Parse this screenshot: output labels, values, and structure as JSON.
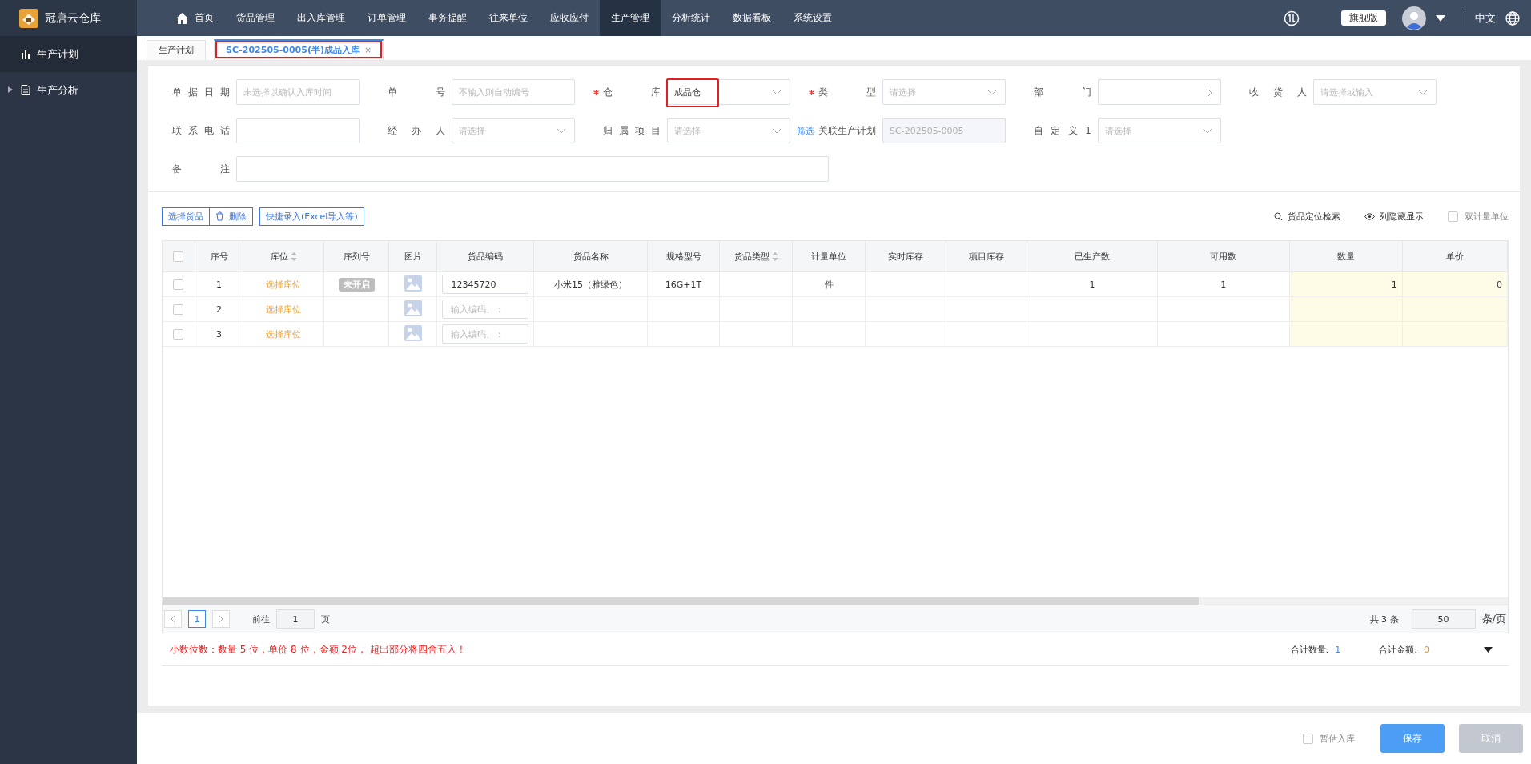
{
  "brand": {
    "name": "冠唐云仓库"
  },
  "nav": [
    {
      "label": "首页",
      "kind": "home",
      "selected": false
    },
    {
      "label": "货品管理",
      "selected": false
    },
    {
      "label": "出入库管理",
      "selected": false
    },
    {
      "label": "订单管理",
      "selected": false
    },
    {
      "label": "事务提醒",
      "selected": false
    },
    {
      "label": "往来单位",
      "selected": false
    },
    {
      "label": "应收应付",
      "selected": false
    },
    {
      "label": "生产管理",
      "selected": true
    },
    {
      "label": "分析统计",
      "selected": false
    },
    {
      "label": "数据看板",
      "selected": false
    },
    {
      "label": "系统设置",
      "selected": false
    }
  ],
  "header_right": {
    "edition": "旗舰版",
    "language": "中文"
  },
  "sidebar": {
    "items": [
      {
        "label": "生产计划",
        "kind": "chart",
        "selected": true
      },
      {
        "label": "生产分析",
        "kind": "doc",
        "selected": false,
        "expanded": false
      }
    ]
  },
  "tabs": [
    {
      "label": "生产计划",
      "selected": false,
      "highlighted": false
    },
    {
      "label": "SC-202505-0005(半)成品入库",
      "selected": true,
      "highlighted": true,
      "close": "×"
    }
  ],
  "form": {
    "rows": [
      [
        {
          "label": "单据日期",
          "kind": "text",
          "placeholder": "未选择以确认入库时间"
        },
        {
          "label": "单号",
          "kind": "text",
          "placeholder": "不输入则自动编号"
        },
        {
          "label": "仓库",
          "kind": "select",
          "required": true,
          "value": "成品仓",
          "highlighted": true
        },
        {
          "label": "类型",
          "kind": "select",
          "required": true,
          "placeholder": "请选择"
        },
        {
          "label": "部门",
          "kind": "cascade"
        },
        {
          "label": "收货人",
          "kind": "select",
          "placeholder": "请选择或输入"
        }
      ],
      [
        {
          "label": "联系电话",
          "kind": "text"
        },
        {
          "label": "经办人",
          "kind": "select",
          "placeholder": "请选择"
        },
        {
          "label": "归属项目",
          "kind": "select",
          "placeholder": "请选择",
          "link": "筛选"
        },
        {
          "label": "关联生产计划",
          "kind": "disabled",
          "value": "SC-202505-0005"
        },
        {
          "label": "自定义1",
          "kind": "select",
          "placeholder": "请选择"
        }
      ],
      [
        {
          "label": "备注",
          "kind": "wide"
        }
      ]
    ]
  },
  "toolbar": {
    "buttons": [
      {
        "label": "选择货品",
        "kind": "plain"
      },
      {
        "label": "删除",
        "kind": "trash"
      },
      {
        "label": "快捷录入(Excel导入等)",
        "kind": "standalone"
      }
    ],
    "tools": [
      {
        "label": "货品定位检索",
        "kind": "search"
      },
      {
        "label": "列隐藏显示",
        "kind": "eye"
      }
    ],
    "dual_unit": {
      "label": "双计量单位",
      "checked": false
    }
  },
  "table": {
    "select_all_checked": false,
    "columns": [
      {
        "label": "序号"
      },
      {
        "label": "库位",
        "sortable": true
      },
      {
        "label": "序列号"
      },
      {
        "label": "图片"
      },
      {
        "label": "货品编码"
      },
      {
        "label": "货品名称"
      },
      {
        "label": "规格型号"
      },
      {
        "label": "货品类型",
        "sortable": true
      },
      {
        "label": "计量单位"
      },
      {
        "label": "实时库存"
      },
      {
        "label": "项目库存"
      },
      {
        "label": "已生产数"
      },
      {
        "label": "可用数"
      },
      {
        "label": "数量"
      },
      {
        "label": "单价"
      }
    ],
    "rows": [
      {
        "checked": false,
        "no": "1",
        "location": "选择库位",
        "serial": "未开启",
        "code": "12345720",
        "name": "小米15（雅绿色）",
        "spec": "16G+1T",
        "unit": "件",
        "produced": "1",
        "available": "1",
        "qty": "1",
        "price": "0"
      },
      {
        "checked": false,
        "no": "2",
        "location": "选择库位",
        "code_placeholder": "输入编码、："
      },
      {
        "checked": false,
        "no": "3",
        "location": "选择库位",
        "code_placeholder": "输入编码、："
      }
    ]
  },
  "pager": {
    "pages": [
      {
        "label": "1",
        "selected": true
      }
    ],
    "goto_label": "前往",
    "goto_value": "1",
    "goto_unit": "页",
    "total": "共 3 条",
    "page_size": "50",
    "size_unit": "条/页"
  },
  "summary": {
    "note": "小数位数：数量 5 位，单价 8 位，金额 2位， 超出部分将四舍五入！",
    "qty_label": "合计数量:",
    "qty": "1",
    "amount_label": "合计金额:",
    "amount": "0"
  },
  "footer": {
    "estimate": {
      "label": "暂估入库",
      "checked": false
    },
    "save": "保存",
    "cancel": {
      "label": "取消",
      "disabled": true
    }
  }
}
